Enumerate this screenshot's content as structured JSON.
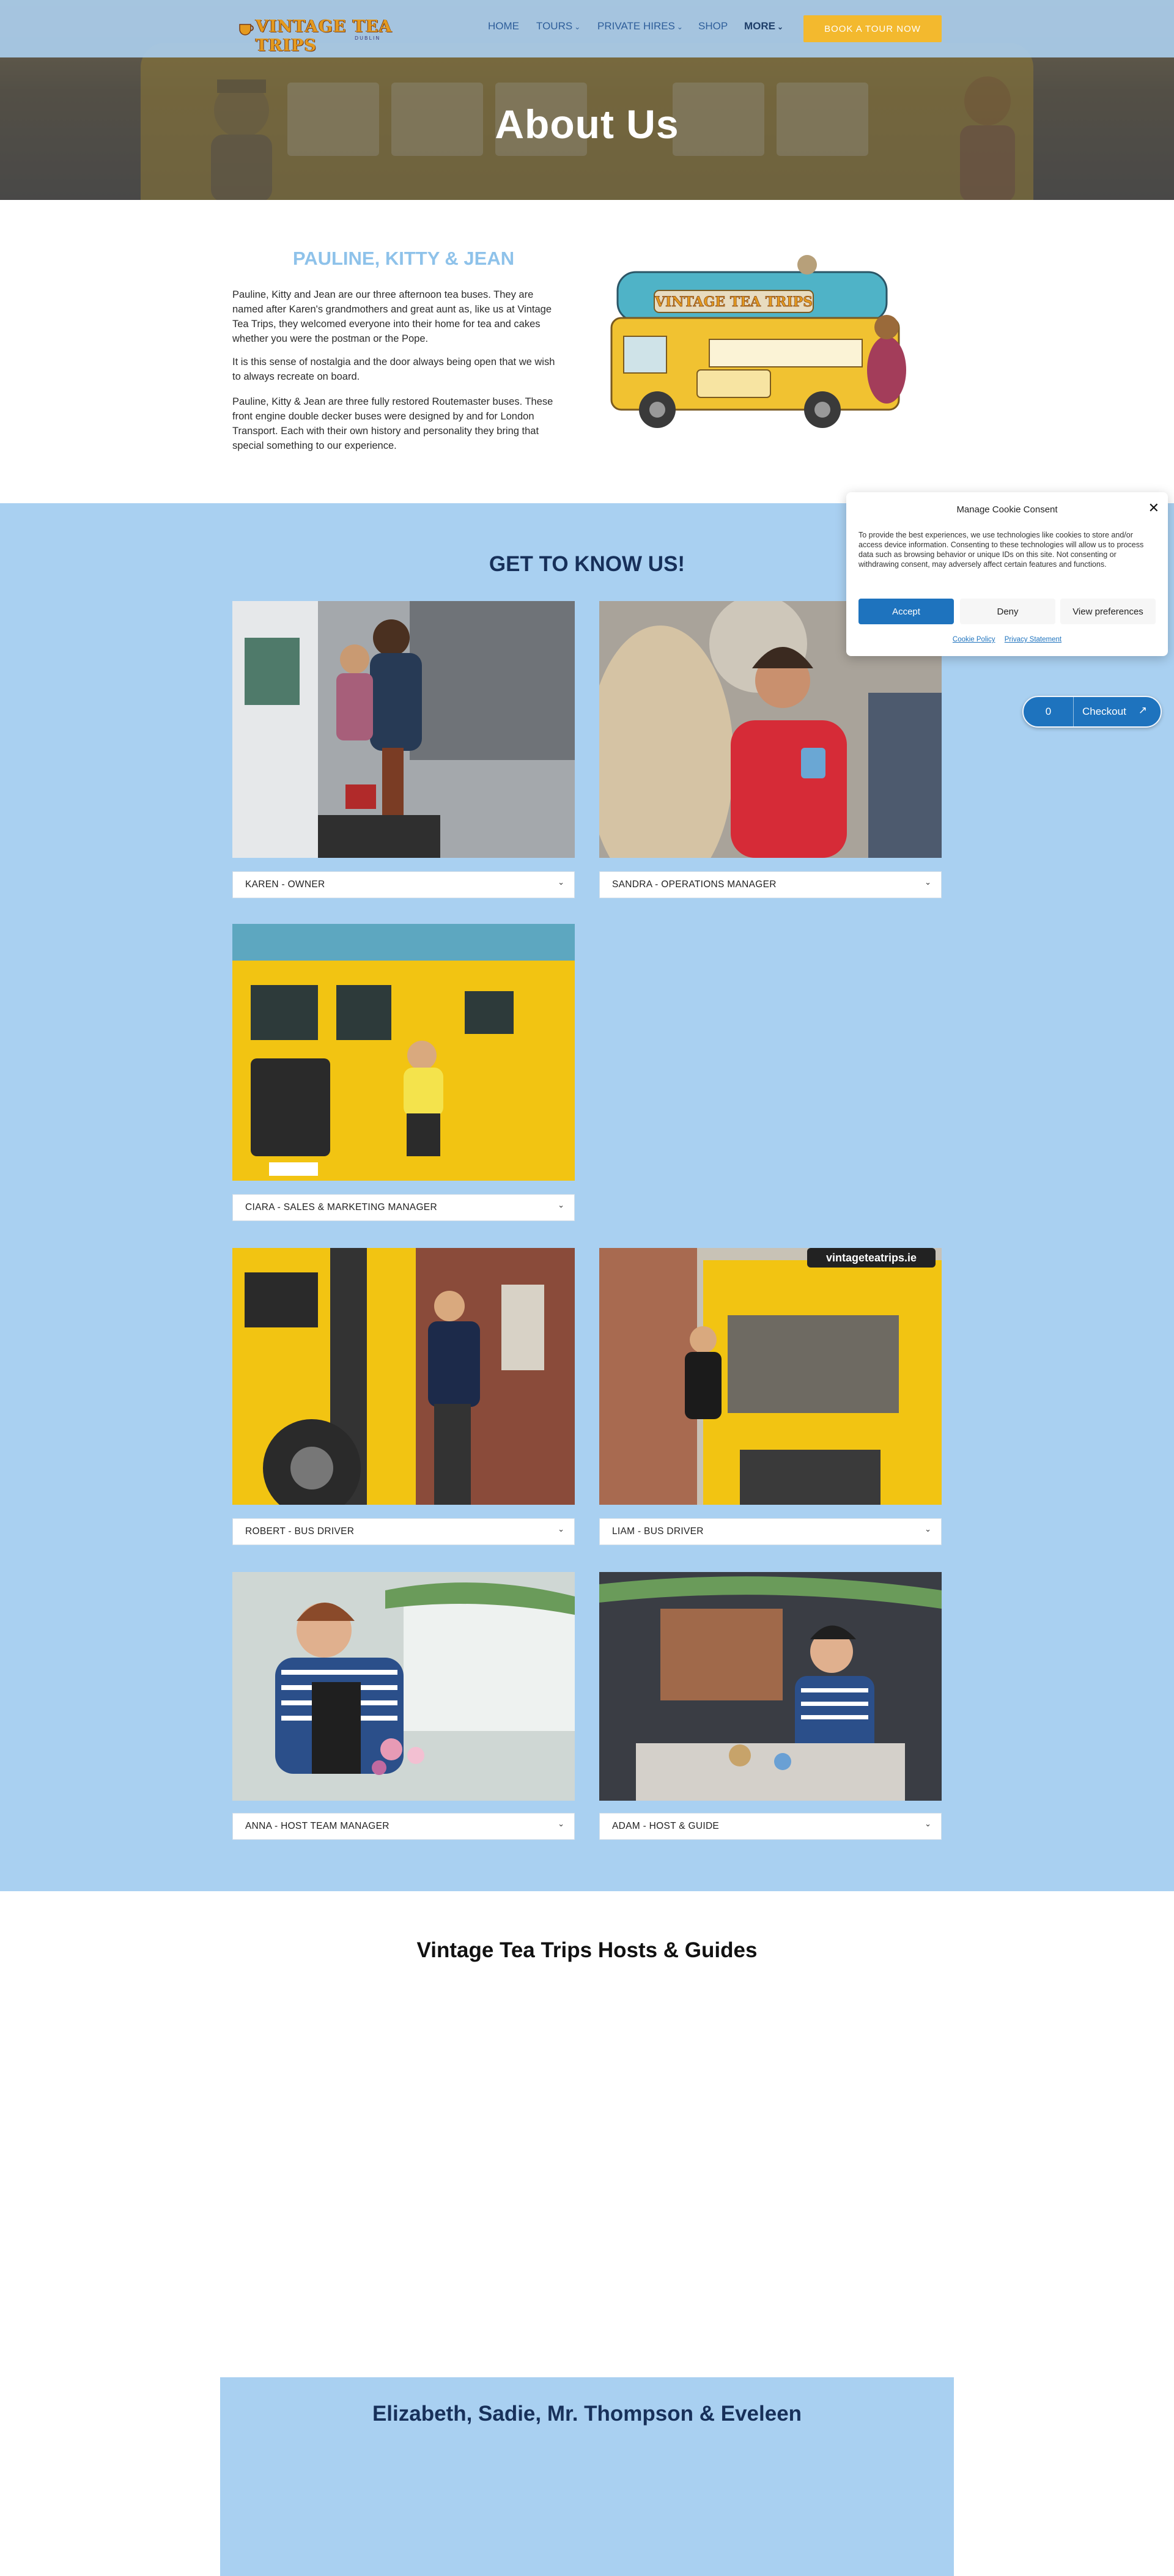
{
  "header": {
    "logo_text": "VINTAGE TEA TRIPS",
    "logo_sub": "DUBLIN",
    "nav": [
      "HOME",
      "TOURS",
      "PRIVATE HIRES",
      "SHOP",
      "MORE"
    ],
    "book_label": "BOOK A TOUR NOW"
  },
  "hero": {
    "title": "About Us"
  },
  "intro": {
    "title": "PAULINE, KITTY & JEAN",
    "paragraphs": [
      "Pauline, Kitty and Jean are our three afternoon tea buses. They are named after Karen's grandmothers and great aunt as, like us at Vintage Tea Trips, they welcomed everyone into their home for tea and cakes whether you were the postman or the Pope.",
      "It is this sense of nostalgia and the door always being open that we wish to always recreate on board.",
      "Pauline, Kitty & Jean are three fully restored Routemaster buses. These front engine double decker buses were designed by and for London Transport. Each with their own history and personality they bring that special something to our experience."
    ]
  },
  "team": {
    "title": "GET TO KNOW US!",
    "members": [
      "KAREN - OWNER",
      "SANDRA - OPERATIONS MANAGER",
      "CIARA - SALES & MARKETING MANAGER",
      "ROBERT - BUS DRIVER",
      "LIAM - BUS DRIVER",
      "ANNA - HOST TEAM MANAGER",
      "ADAM - HOST & GUIDE"
    ]
  },
  "cookie": {
    "title": "Manage Cookie Consent",
    "text": "To provide the best experiences, we use technologies like cookies to store and/or access device information. Consenting to these technologies will allow us to process data such as browsing behavior or unique IDs on this site. Not consenting or withdrawing consent, may adversely affect certain features and functions.",
    "accept": "Accept",
    "deny": "Deny",
    "preferences": "View preferences",
    "cookie_policy": "Cookie Policy",
    "privacy": "Privacy Statement"
  },
  "checkout": {
    "count": "0",
    "label": "Checkout"
  },
  "hosts": {
    "title": "Vintage Tea Trips Hosts & Guides"
  },
  "bottom": {
    "title": "Elizabeth, Sadie, Mr. Thompson & Eveleen"
  },
  "colors": {
    "accent": "#f3b92e",
    "sky": "#a9d0f1",
    "navy": "#17305a",
    "link": "#1e73be"
  },
  "icons": [
    "chevron-down-icon",
    "close-icon",
    "external-link-icon"
  ]
}
